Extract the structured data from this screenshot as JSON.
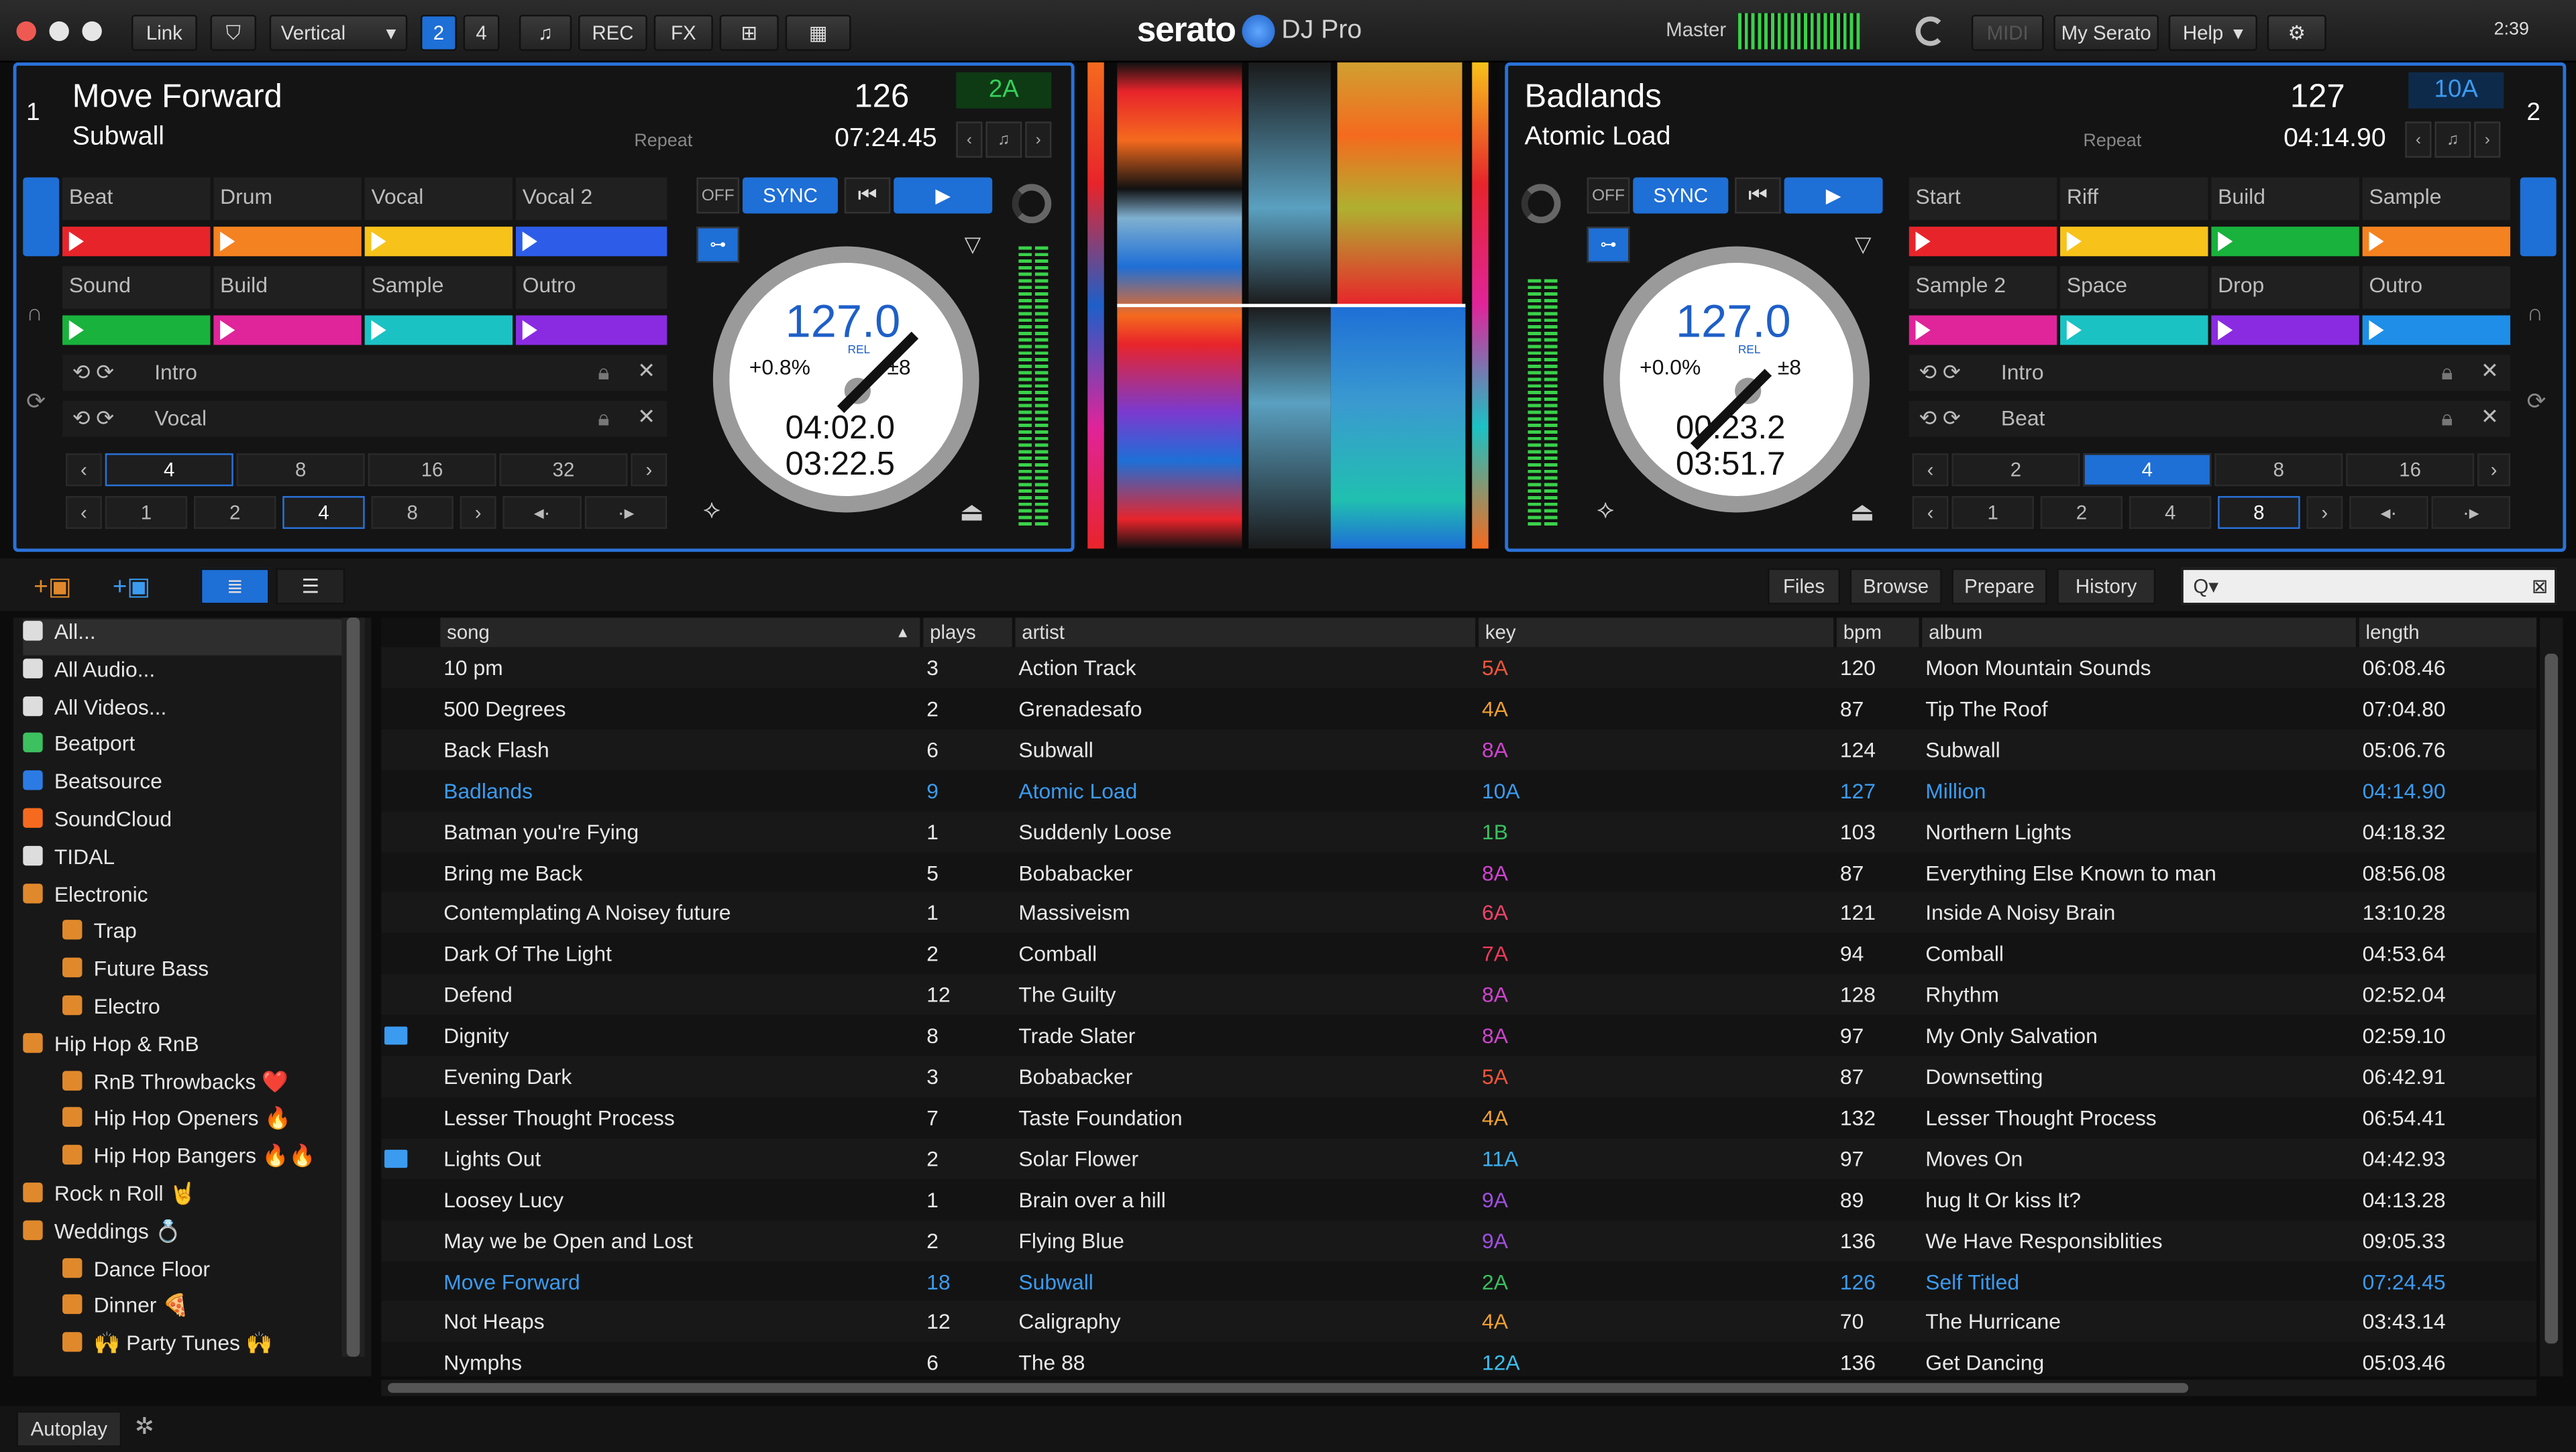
{
  "topbar": {
    "link": "Link",
    "layout": "Vertical",
    "deck_2": "2",
    "deck_4": "4",
    "rec": "REC",
    "fx": "FX",
    "brand": "serato",
    "brand_product": "DJ Pro",
    "master": "Master",
    "midi": "MIDI",
    "my_serato": "My Serato",
    "help": "Help",
    "time": "2:39"
  },
  "deck1": {
    "number": "1",
    "title": "Move Forward",
    "artist": "Subwall",
    "bpm": "126",
    "key": "2A",
    "repeat": "Repeat",
    "time": "07:24.45",
    "pads": [
      {
        "label": "Beat",
        "color": "#e8242b"
      },
      {
        "label": "Drum",
        "color": "#f58220"
      },
      {
        "label": "Vocal",
        "color": "#f7c21a"
      },
      {
        "label": "Vocal 2",
        "color": "#2d5de8"
      },
      {
        "label": "Sound",
        "color": "#18b23c"
      },
      {
        "label": "Build",
        "color": "#e0249a"
      },
      {
        "label": "Sample",
        "color": "#1bc2c4"
      },
      {
        "label": "Outro",
        "color": "#8a2be2"
      }
    ],
    "loops": [
      "Intro",
      "Vocal"
    ],
    "loop_sizes": [
      "4",
      "8",
      "16",
      "32"
    ],
    "beat_sizes": [
      "1",
      "2",
      "4",
      "8"
    ],
    "off": "OFF",
    "sync": "SYNC",
    "platter_bpm": "127.0",
    "rel": "REL",
    "pitch": "+0.8%",
    "range": "±8",
    "elapsed": "04:02.0",
    "remaining": "03:22.5"
  },
  "deck2": {
    "number": "2",
    "title": "Badlands",
    "artist": "Atomic Load",
    "bpm": "127",
    "key": "10A",
    "repeat": "Repeat",
    "time": "04:14.90",
    "pads": [
      {
        "label": "Start",
        "color": "#e8242b"
      },
      {
        "label": "Riff",
        "color": "#f7c21a"
      },
      {
        "label": "Build",
        "color": "#18b23c"
      },
      {
        "label": "Sample",
        "color": "#f58220"
      },
      {
        "label": "Sample 2",
        "color": "#e0249a"
      },
      {
        "label": "Space",
        "color": "#1bc2c4"
      },
      {
        "label": "Drop",
        "color": "#8a2be2"
      },
      {
        "label": "Outro",
        "color": "#1e8ee8"
      }
    ],
    "loops": [
      "Intro",
      "Beat"
    ],
    "loop_sizes": [
      "2",
      "4",
      "8",
      "16"
    ],
    "beat_sizes": [
      "1",
      "2",
      "4",
      "8"
    ],
    "off": "OFF",
    "sync": "SYNC",
    "platter_bpm": "127.0",
    "rel": "REL",
    "pitch": "+0.0%",
    "range": "±8",
    "elapsed": "00:23.2",
    "remaining": "03:51.7"
  },
  "library": {
    "files": "Files",
    "browse": "Browse",
    "prepare": "Prepare",
    "history": "History",
    "search_placeholder": "Q▾",
    "autoplay": "Autoplay"
  },
  "crates": [
    {
      "label": "All...",
      "indent": 0,
      "icon": "#ddd"
    },
    {
      "label": "All Audio...",
      "indent": 0,
      "icon": "#ddd"
    },
    {
      "label": "All Videos...",
      "indent": 0,
      "icon": "#ddd"
    },
    {
      "label": "Beatport",
      "indent": 0,
      "icon": "#3cc060"
    },
    {
      "label": "Beatsource",
      "indent": 0,
      "icon": "#2c7be5"
    },
    {
      "label": "SoundCloud",
      "indent": 0,
      "icon": "#f56a1e"
    },
    {
      "label": "TIDAL",
      "indent": 0,
      "icon": "#ddd"
    },
    {
      "label": "Electronic",
      "indent": 0,
      "icon": "#e0892c"
    },
    {
      "label": "Trap",
      "indent": 1,
      "icon": "#e0892c"
    },
    {
      "label": "Future Bass",
      "indent": 1,
      "icon": "#e0892c"
    },
    {
      "label": "Electro",
      "indent": 1,
      "icon": "#e0892c"
    },
    {
      "label": "Hip Hop & RnB",
      "indent": 0,
      "icon": "#e0892c"
    },
    {
      "label": "RnB Throwbacks ❤️",
      "indent": 1,
      "icon": "#e0892c"
    },
    {
      "label": "Hip Hop Openers 🔥",
      "indent": 1,
      "icon": "#e0892c"
    },
    {
      "label": "Hip Hop Bangers 🔥🔥",
      "indent": 1,
      "icon": "#e0892c"
    },
    {
      "label": "Rock n Roll 🤘",
      "indent": 0,
      "icon": "#e0892c"
    },
    {
      "label": "Weddings 💍",
      "indent": 0,
      "icon": "#e0892c"
    },
    {
      "label": "Dance Floor",
      "indent": 1,
      "icon": "#e0892c"
    },
    {
      "label": "Dinner 🍕",
      "indent": 1,
      "icon": "#e0892c"
    },
    {
      "label": "🙌 Party Tunes 🙌",
      "indent": 1,
      "icon": "#e0892c"
    }
  ],
  "columns": {
    "song": "song",
    "plays": "plays",
    "artist": "artist",
    "key": "key",
    "bpm": "bpm",
    "album": "album",
    "length": "length"
  },
  "tracks": [
    {
      "song": "10 pm",
      "plays": "3",
      "artist": "Action Track",
      "key": "5A",
      "key_color": "#f0553a",
      "bpm": "120",
      "album": "Moon Mountain Sounds",
      "length": "06:08.46",
      "hl": false,
      "mark": false
    },
    {
      "song": "500 Degrees",
      "plays": "2",
      "artist": "Grenadesafo",
      "key": "4A",
      "key_color": "#f0a030",
      "bpm": "87",
      "album": "Tip The Roof",
      "length": "07:04.80",
      "hl": false,
      "mark": false
    },
    {
      "song": "Back Flash",
      "plays": "6",
      "artist": "Subwall",
      "key": "8A",
      "key_color": "#d044d0",
      "bpm": "124",
      "album": "Subwall",
      "length": "05:06.76",
      "hl": false,
      "mark": false
    },
    {
      "song": "Badlands",
      "plays": "9",
      "artist": "Atomic Load",
      "key": "10A",
      "key_color": "#3b9bf0",
      "bpm": "127",
      "album": "Million",
      "length": "04:14.90",
      "hl": true,
      "mark": false
    },
    {
      "song": "Batman you're Fying",
      "plays": "1",
      "artist": "Suddenly Loose",
      "key": "1B",
      "key_color": "#39c060",
      "bpm": "103",
      "album": "Northern Lights",
      "length": "04:18.32",
      "hl": false,
      "mark": false
    },
    {
      "song": "Bring me Back",
      "plays": "5",
      "artist": "Bobabacker",
      "key": "8A",
      "key_color": "#d044d0",
      "bpm": "87",
      "album": "Everything Else Known to man",
      "length": "08:56.08",
      "hl": false,
      "mark": false
    },
    {
      "song": "Contemplating A Noisey future",
      "plays": "1",
      "artist": "Massiveism",
      "key": "6A",
      "key_color": "#f0446a",
      "bpm": "121",
      "album": "Inside A Noisy Brain",
      "length": "13:10.28",
      "hl": false,
      "mark": false
    },
    {
      "song": "Dark Of The Light",
      "plays": "2",
      "artist": "Comball",
      "key": "7A",
      "key_color": "#f03a5a",
      "bpm": "94",
      "album": "Comball",
      "length": "04:53.64",
      "hl": false,
      "mark": false
    },
    {
      "song": "Defend",
      "plays": "12",
      "artist": "The Guilty",
      "key": "8A",
      "key_color": "#d044d0",
      "bpm": "128",
      "album": "Rhythm",
      "length": "02:52.04",
      "hl": false,
      "mark": false
    },
    {
      "song": "Dignity",
      "plays": "8",
      "artist": "Trade Slater",
      "key": "8A",
      "key_color": "#d044d0",
      "bpm": "97",
      "album": "My Only Salvation",
      "length": "02:59.10",
      "hl": false,
      "mark": true
    },
    {
      "song": "Evening Dark",
      "plays": "3",
      "artist": "Bobabacker",
      "key": "5A",
      "key_color": "#f0553a",
      "bpm": "87",
      "album": "Downsetting",
      "length": "06:42.91",
      "hl": false,
      "mark": false
    },
    {
      "song": "Lesser Thought Process",
      "plays": "7",
      "artist": "Taste Foundation",
      "key": "4A",
      "key_color": "#f0a030",
      "bpm": "132",
      "album": "Lesser Thought Process",
      "length": "06:54.41",
      "hl": false,
      "mark": false
    },
    {
      "song": "Lights Out",
      "plays": "2",
      "artist": "Solar Flower",
      "key": "11A",
      "key_color": "#3bb0f0",
      "bpm": "97",
      "album": "Moves On",
      "length": "04:42.93",
      "hl": false,
      "mark": true
    },
    {
      "song": "Loosey Lucy",
      "plays": "1",
      "artist": "Brain over a hill",
      "key": "9A",
      "key_color": "#a050e0",
      "bpm": "89",
      "album": "hug It Or kiss It?",
      "length": "04:13.28",
      "hl": false,
      "mark": false
    },
    {
      "song": "May we be Open and Lost",
      "plays": "2",
      "artist": "Flying Blue",
      "key": "9A",
      "key_color": "#a050e0",
      "bpm": "136",
      "album": "We Have Responsiblities",
      "length": "09:05.33",
      "hl": false,
      "mark": false
    },
    {
      "song": "Move Forward",
      "plays": "18",
      "artist": "Subwall",
      "key": "2A",
      "key_color": "#39c060",
      "bpm": "126",
      "album": "Self Titled",
      "length": "07:24.45",
      "hl": true,
      "mark": false
    },
    {
      "song": "Not Heaps",
      "plays": "12",
      "artist": "Caligraphy",
      "key": "4A",
      "key_color": "#f0a030",
      "bpm": "70",
      "album": "The Hurricane",
      "length": "03:43.14",
      "hl": false,
      "mark": false
    },
    {
      "song": "Nymphs",
      "plays": "6",
      "artist": "The 88",
      "key": "12A",
      "key_color": "#3bc0f0",
      "bpm": "136",
      "album": "Get Dancing",
      "length": "05:03.46",
      "hl": false,
      "mark": false
    }
  ]
}
